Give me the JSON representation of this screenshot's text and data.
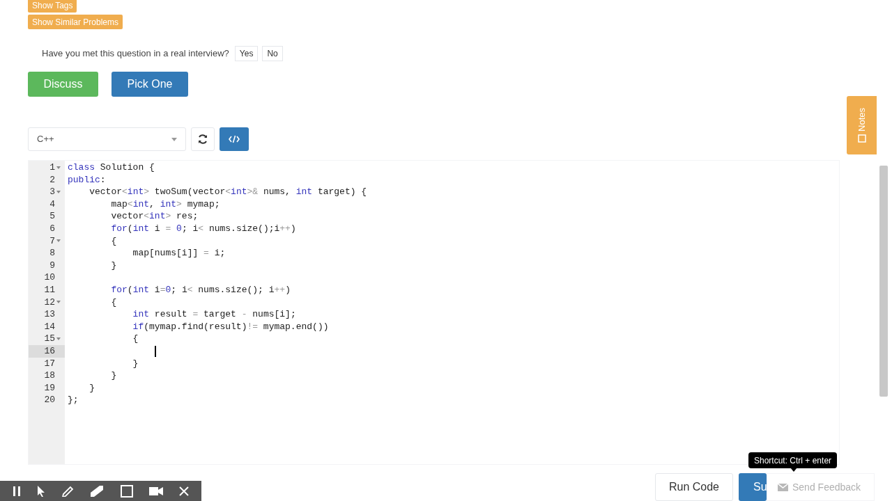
{
  "top_buttons": [
    "Show Tags",
    "Show Similar Problems"
  ],
  "interview": {
    "question": "Have you met this question in a real interview?",
    "answers": [
      "Yes",
      "No"
    ]
  },
  "actions": [
    {
      "label": "Discuss",
      "kind": "discuss"
    },
    {
      "label": "Pick One",
      "kind": "pick"
    }
  ],
  "notes_tab": "Notes",
  "editor": {
    "language": "C++",
    "lines": [
      {
        "number": "1",
        "fold": true,
        "active": false,
        "tokens": [
          {
            "text": "class",
            "kind": "keyword"
          },
          {
            "text": " Solution {",
            "kind": "plain"
          }
        ]
      },
      {
        "number": "2",
        "fold": false,
        "active": false,
        "tokens": [
          {
            "text": "public",
            "kind": "keyword"
          },
          {
            "text": ":",
            "kind": "plain"
          }
        ]
      },
      {
        "number": "3",
        "fold": true,
        "active": false,
        "tokens": [
          {
            "text": "    vector",
            "kind": "plain"
          },
          {
            "text": "<",
            "kind": "operator"
          },
          {
            "text": "int",
            "kind": "keyword"
          },
          {
            "text": ">",
            "kind": "operator"
          },
          {
            "text": " twoSum(vector",
            "kind": "plain"
          },
          {
            "text": "<",
            "kind": "operator"
          },
          {
            "text": "int",
            "kind": "keyword"
          },
          {
            "text": ">&",
            "kind": "operator"
          },
          {
            "text": " nums, ",
            "kind": "plain"
          },
          {
            "text": "int",
            "kind": "keyword"
          },
          {
            "text": " target) {",
            "kind": "plain"
          }
        ]
      },
      {
        "number": "4",
        "fold": false,
        "active": false,
        "tokens": [
          {
            "text": "        map",
            "kind": "plain"
          },
          {
            "text": "<",
            "kind": "operator"
          },
          {
            "text": "int",
            "kind": "keyword"
          },
          {
            "text": ", ",
            "kind": "plain"
          },
          {
            "text": "int",
            "kind": "keyword"
          },
          {
            "text": ">",
            "kind": "operator"
          },
          {
            "text": " mymap;",
            "kind": "plain"
          }
        ]
      },
      {
        "number": "5",
        "fold": false,
        "active": false,
        "tokens": [
          {
            "text": "        vector",
            "kind": "plain"
          },
          {
            "text": "<",
            "kind": "operator"
          },
          {
            "text": "int",
            "kind": "keyword"
          },
          {
            "text": ">",
            "kind": "operator"
          },
          {
            "text": " res;",
            "kind": "plain"
          }
        ]
      },
      {
        "number": "6",
        "fold": false,
        "active": false,
        "tokens": [
          {
            "text": "        for",
            "kind": "keyword"
          },
          {
            "text": "(",
            "kind": "plain"
          },
          {
            "text": "int",
            "kind": "keyword"
          },
          {
            "text": " i ",
            "kind": "plain"
          },
          {
            "text": "=",
            "kind": "operator"
          },
          {
            "text": " 0",
            "kind": "number"
          },
          {
            "text": "; i",
            "kind": "plain"
          },
          {
            "text": "<",
            "kind": "operator"
          },
          {
            "text": " nums.size();i",
            "kind": "plain"
          },
          {
            "text": "++",
            "kind": "operator"
          },
          {
            "text": ")",
            "kind": "plain"
          }
        ]
      },
      {
        "number": "7",
        "fold": true,
        "active": false,
        "tokens": [
          {
            "text": "        {",
            "kind": "plain"
          }
        ]
      },
      {
        "number": "8",
        "fold": false,
        "active": false,
        "tokens": [
          {
            "text": "            map[nums[i]] ",
            "kind": "plain"
          },
          {
            "text": "=",
            "kind": "operator"
          },
          {
            "text": " i;",
            "kind": "plain"
          }
        ]
      },
      {
        "number": "9",
        "fold": false,
        "active": false,
        "tokens": [
          {
            "text": "        }",
            "kind": "plain"
          }
        ]
      },
      {
        "number": "10",
        "fold": false,
        "active": false
      },
      {
        "number": "11",
        "fold": false,
        "active": false,
        "tokens": [
          {
            "text": "        for",
            "kind": "keyword"
          },
          {
            "text": "(",
            "kind": "plain"
          },
          {
            "text": "int",
            "kind": "keyword"
          },
          {
            "text": " i",
            "kind": "plain"
          },
          {
            "text": "=",
            "kind": "operator"
          },
          {
            "text": "0",
            "kind": "number"
          },
          {
            "text": "; i",
            "kind": "plain"
          },
          {
            "text": "<",
            "kind": "operator"
          },
          {
            "text": " nums.size(); i",
            "kind": "plain"
          },
          {
            "text": "++",
            "kind": "operator"
          },
          {
            "text": ")",
            "kind": "plain"
          }
        ]
      },
      {
        "number": "12",
        "fold": true,
        "active": false,
        "tokens": [
          {
            "text": "        {",
            "kind": "plain"
          }
        ]
      },
      {
        "number": "13",
        "fold": false,
        "active": false,
        "tokens": [
          {
            "text": "            int",
            "kind": "keyword"
          },
          {
            "text": " result ",
            "kind": "plain"
          },
          {
            "text": "=",
            "kind": "operator"
          },
          {
            "text": " target ",
            "kind": "plain"
          },
          {
            "text": "-",
            "kind": "operator"
          },
          {
            "text": " nums[i];",
            "kind": "plain"
          }
        ]
      },
      {
        "number": "14",
        "fold": false,
        "active": false,
        "tokens": [
          {
            "text": "            if",
            "kind": "keyword"
          },
          {
            "text": "(mymap.find(result)",
            "kind": "plain"
          },
          {
            "text": "!=",
            "kind": "operator"
          },
          {
            "text": " mymap.end())",
            "kind": "plain"
          }
        ]
      },
      {
        "number": "15",
        "fold": true,
        "active": false,
        "tokens": [
          {
            "text": "            {",
            "kind": "plain"
          }
        ]
      },
      {
        "number": "16",
        "fold": false,
        "active": true
      },
      {
        "number": "17",
        "fold": false,
        "active": false,
        "tokens": [
          {
            "text": "            }",
            "kind": "plain"
          }
        ]
      },
      {
        "number": "18",
        "fold": false,
        "active": false,
        "tokens": [
          {
            "text": "        }",
            "kind": "plain"
          }
        ]
      },
      {
        "number": "19",
        "fold": false,
        "active": false,
        "tokens": [
          {
            "text": "    }",
            "kind": "plain"
          }
        ]
      },
      {
        "number": "20",
        "fold": false,
        "active": false,
        "tokens": [
          {
            "text": "};",
            "kind": "plain"
          }
        ]
      }
    ]
  },
  "tooltip": "Shortcut: Ctrl + enter",
  "bottom_buttons": [
    {
      "label": "Run Code",
      "kind": "run"
    },
    {
      "label": "Su",
      "kind": "submit"
    }
  ],
  "feedback": "Send Feedback"
}
